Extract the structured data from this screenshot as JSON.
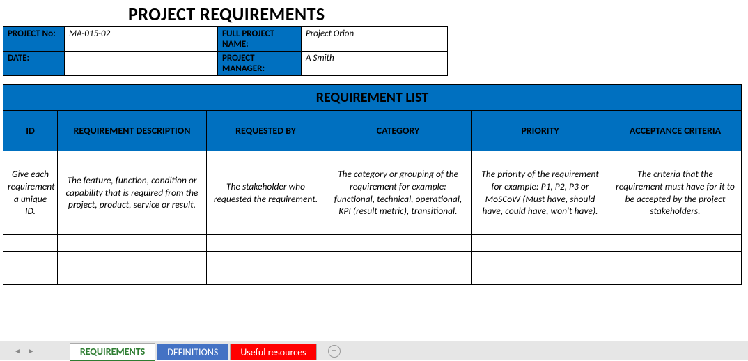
{
  "title": "PROJECT REQUIREMENTS",
  "info": {
    "project_no_label": "PROJECT No:",
    "project_no": "MA-015-02",
    "full_name_label": "FULL PROJECT NAME:",
    "full_name": "Project Orion",
    "date_label": "DATE:",
    "date": "",
    "pm_label": "PROJECT MANAGER:",
    "pm": "A Smith"
  },
  "section_header": "REQUIREMENT LIST",
  "columns": {
    "id": "ID",
    "desc": "REQUIREMENT DESCRIPTION",
    "req_by": "REQUESTED BY",
    "category": "CATEGORY",
    "priority": "PRIORITY",
    "acceptance": "ACCEPTANCE CRITERIA"
  },
  "hints": {
    "id": "Give each requirement a unique ID.",
    "desc": "The feature, function, condition or capability that is required from the project, product, service or result.",
    "req_by": "The stakeholder who requested the requirement.",
    "category": "The category or grouping of the requirement for example: functional, technical, operational, KPI (result metric), transitional.",
    "priority": "The priority of the requirement for example: P1, P2, P3 or MoSCoW (Must have, should have, could have, won't have).",
    "acceptance": "The criteria that the requirement must have for it to be accepted by the project stakeholders."
  },
  "tabs": {
    "requirements": "REQUIREMENTS",
    "definitions": "DEFINITIONS",
    "resources": "Useful resources"
  }
}
